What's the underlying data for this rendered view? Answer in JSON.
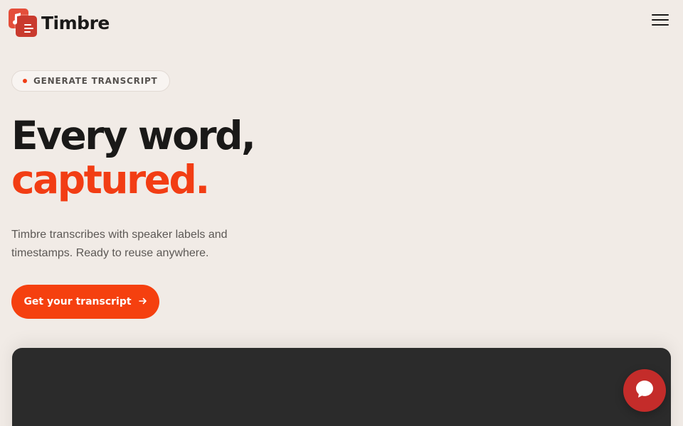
{
  "header": {
    "brand_name": "Timbre",
    "logo_icon": "music-note-logo-icon",
    "menu_icon": "hamburger-menu-icon"
  },
  "hero": {
    "badge_label": "GENERATE TRANSCRIPT",
    "headline_line1": "Every word,",
    "headline_line2": "captured.",
    "subtext": "Timbre transcribes with speaker labels and timestamps. Ready to reuse anywhere.",
    "cta_label": "Get your transcript",
    "cta_icon": "arrow-right-icon"
  },
  "chat_widget": {
    "icon": "chat-bubble-icon"
  },
  "colors": {
    "background": "#f1ebe6",
    "accent": "#f5400f",
    "headline_dark": "#1a1918",
    "panel_dark": "#2b2b2b",
    "chat_button": "#c42c2a"
  }
}
